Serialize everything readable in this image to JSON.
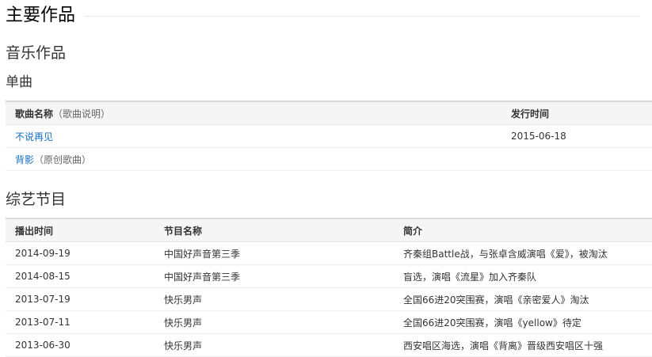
{
  "headings": {
    "main": "主要作品",
    "music": "音乐作品",
    "singles": "单曲",
    "variety": "综艺节目"
  },
  "singles_table": {
    "col_name": "歌曲名称",
    "col_name_note": "（歌曲说明）",
    "col_date": "发行时间",
    "rows": [
      {
        "name": "不说再见",
        "note": "",
        "date": "2015-06-18"
      },
      {
        "name": "背影",
        "note": "（原创歌曲）",
        "date": ""
      }
    ]
  },
  "variety_table": {
    "col_date": "播出时间",
    "col_show": "节目名称",
    "col_intro": "简介",
    "rows": [
      {
        "date": "2014-09-19",
        "show": "中国好声音第三季",
        "intro": "齐秦组Battle战，与张卓含威演唱《爱》，被淘汰"
      },
      {
        "date": "2014-08-15",
        "show": "中国好声音第三季",
        "intro": "盲选，演唱《流星》加入齐秦队"
      },
      {
        "date": "2013-07-19",
        "show": "快乐男声",
        "intro": "全国66进20突围赛，演唱《亲密爱人》淘汰"
      },
      {
        "date": "2013-07-11",
        "show": "快乐男声",
        "intro": "全国66进20突围赛，演唱《yellow》待定"
      },
      {
        "date": "2013-06-30",
        "show": "快乐男声",
        "intro": "西安唱区海选，演唱《背离》晋级西安唱区十强"
      }
    ]
  },
  "colors": {
    "link": "#136ec2",
    "header_bg": "#f5f5f5"
  }
}
